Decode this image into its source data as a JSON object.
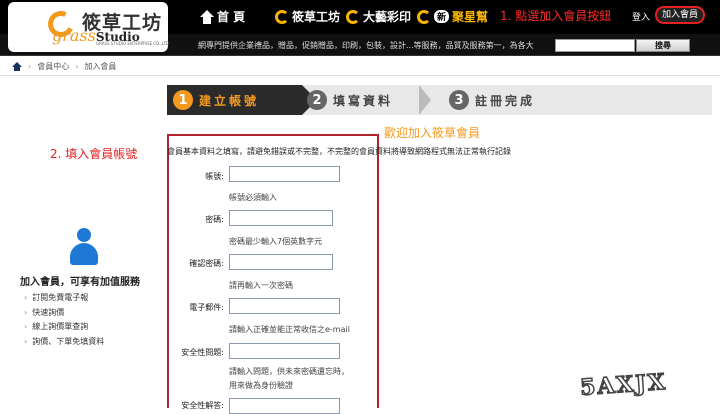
{
  "header": {
    "logo_cn": "筱草工坊",
    "logo_en_1": "grass",
    "logo_en_2": "Studio",
    "logo_sub": "GRASS STUDIO ENTERPRISE CO.,LTD.",
    "menu": [
      {
        "label": "首 頁",
        "icon": "home-icon"
      },
      {
        "label": "筱草工坊",
        "icon": "spiral-icon"
      },
      {
        "label": "大藝彩印",
        "icon": "spiral-icon"
      },
      {
        "label": "聚星幫",
        "icon": "spiral-icon",
        "badge": "新"
      }
    ],
    "step_note": "1. 點選加入會員按鈕",
    "login": "登入",
    "join": "加入會員",
    "marquee": "網專門提供企業禮品，贈品，促銷贈品，印刷，包裝，設計...等服務，品質及服務第一，為各大",
    "search_placeholder": "",
    "search_button": "搜尋"
  },
  "breadcrumb": [
    "會員中心",
    "加入會員"
  ],
  "sidebar": {
    "annotation": "2. 填入會員帳號",
    "benefit_title": "加入會員，可享有加值服務",
    "items": [
      "訂閱免費電子報",
      "快速詢價",
      "線上詢價單查詢",
      "詢價、下單免填資料"
    ]
  },
  "steps": [
    {
      "num": "1",
      "label": "建立帳號"
    },
    {
      "num": "2",
      "label": "填寫資料"
    },
    {
      "num": "3",
      "label": "註冊完成"
    }
  ],
  "welcome": "歡迎加入筱草會員",
  "notice": "會員基本資料之填寫，請避免錯誤或不完整，不完整的會員資料將導致網路程式無法正常執行記錄",
  "form": {
    "account_label": "帳號:",
    "account_hint": "帳號必須輸入",
    "password_label": "密碼:",
    "password_hint": "密碼最少輸入7個英數字元",
    "confirm_label": "確認密碼:",
    "confirm_hint": "請再輸入一次密碼",
    "email_label": "電子郵件:",
    "email_hint": "請輸入正確並能正常收信之e-mail",
    "question_label": "安全性問題:",
    "question_hint_1": "請輸入問題，供未來密碼遺忘時，",
    "question_hint_2": "用來做為身份驗證",
    "answer_label": "安全性解答:"
  },
  "watermark": "5AXJX",
  "colors": {
    "accent": "#f39a1e",
    "annotation": "#e52020",
    "frame": "#b3232b",
    "avatar": "#1e78d6"
  }
}
